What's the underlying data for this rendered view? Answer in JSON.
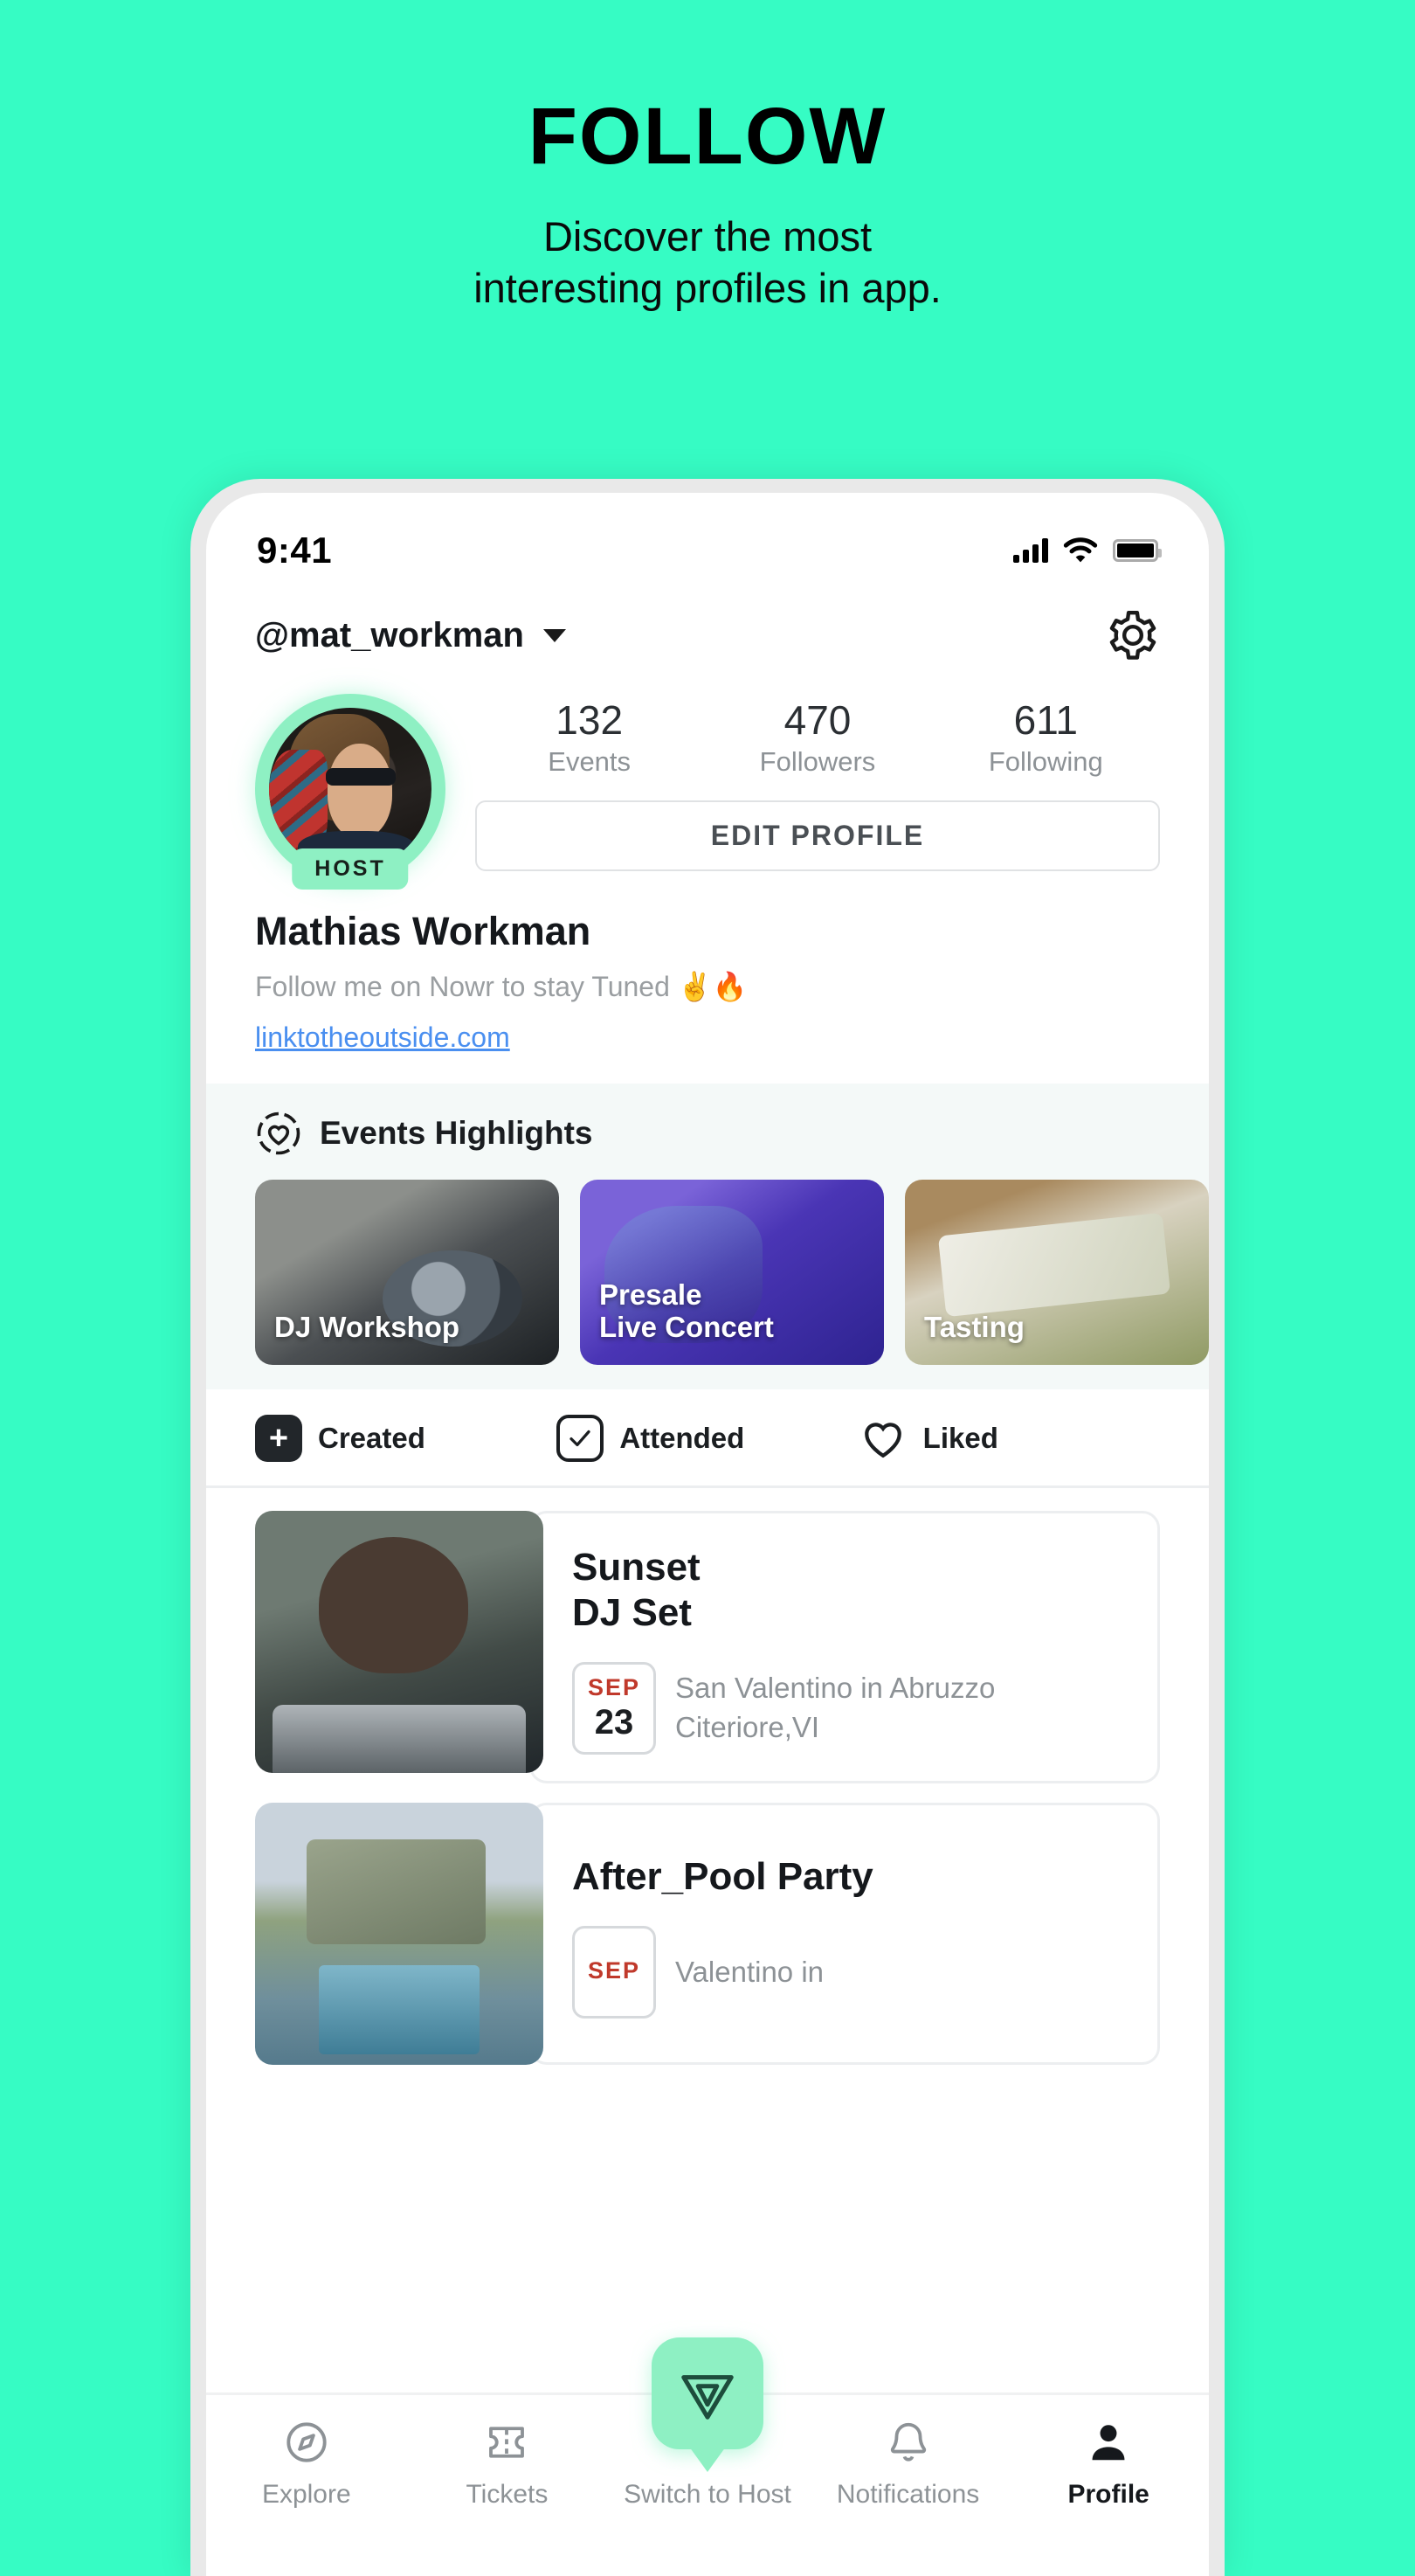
{
  "promo": {
    "title": "FOLLOW",
    "subtitle_line1": "Discover the most",
    "subtitle_line2": "interesting profiles in app."
  },
  "colors": {
    "background": "#36fcc4",
    "accent_mint": "#8ef0c3",
    "link": "#4a8ff0",
    "date_red": "#c0392b",
    "muted_text": "#8d9296"
  },
  "status_bar": {
    "time": "9:41",
    "signal_icon": "cellular-signal-icon",
    "wifi_icon": "wifi-icon",
    "battery_icon": "battery-icon"
  },
  "header": {
    "handle": "@mat_workman",
    "dropdown_icon": "chevron-down-icon",
    "settings_icon": "gear-icon"
  },
  "profile": {
    "avatar_badge": "HOST",
    "stats": [
      {
        "value": "132",
        "label": "Events"
      },
      {
        "value": "470",
        "label": "Followers"
      },
      {
        "value": "611",
        "label": "Following"
      }
    ],
    "edit_button": "EDIT PROFILE",
    "name": "Mathias Workman",
    "bio": "Follow me on Nowr to stay Tuned ✌️🔥",
    "link": "linktotheoutside.com"
  },
  "highlights": {
    "icon": "heart-in-dashed-circle-icon",
    "title": "Events Highlights",
    "cards": [
      {
        "label": "DJ Workshop"
      },
      {
        "label": "Presale\nLive Concert"
      },
      {
        "label": "Tasting"
      }
    ]
  },
  "tabs": [
    {
      "label": "Created",
      "icon": "plus-square-icon",
      "active": true
    },
    {
      "label": "Attended",
      "icon": "check-square-icon",
      "active": false
    },
    {
      "label": "Liked",
      "icon": "heart-icon",
      "active": false
    }
  ],
  "events": [
    {
      "title": "Sunset\nDJ Set",
      "month": "SEP",
      "day": "23",
      "location": "San Valentino in Abruzzo Citeriore,VI"
    },
    {
      "title": "After_Pool Party",
      "month": "SEP",
      "day": "",
      "location": "Valentino in"
    }
  ],
  "navbar": [
    {
      "label": "Explore",
      "icon": "compass-icon",
      "active": false
    },
    {
      "label": "Tickets",
      "icon": "ticket-icon",
      "active": false
    },
    {
      "label": "Switch to Host",
      "icon": "nowr-logo-icon",
      "active": false
    },
    {
      "label": "Notifications",
      "icon": "bell-icon",
      "active": false
    },
    {
      "label": "Profile",
      "icon": "person-icon",
      "active": true
    }
  ]
}
